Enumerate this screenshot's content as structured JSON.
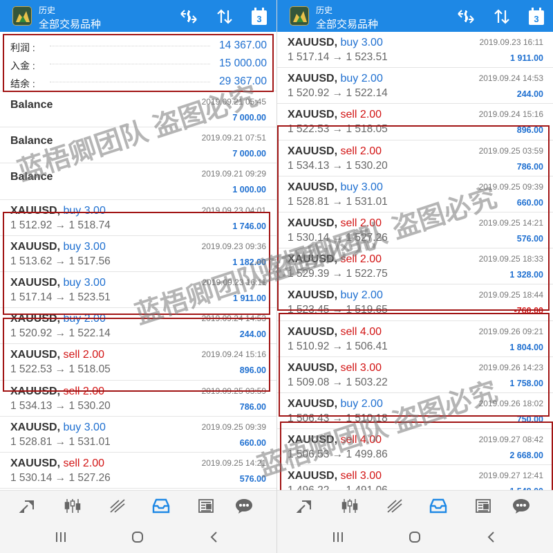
{
  "header": {
    "title_small": "历史",
    "title_main": "全部交易品种",
    "calendar_day": "3"
  },
  "summary": [
    {
      "label": "利润 :",
      "value": "14 367.00"
    },
    {
      "label": "入金 :",
      "value": "15 000.00"
    },
    {
      "label": "结余 :",
      "value": "29 367.00"
    }
  ],
  "balance_entries": [
    {
      "label": "Balance",
      "datetime": "2019.09.21 05:45",
      "amount": "7 000.00"
    },
    {
      "label": "Balance",
      "datetime": "2019.09.21 07:51",
      "amount": "7 000.00"
    },
    {
      "label": "Balance",
      "datetime": "2019.09.21 09:29",
      "amount": "1 000.00"
    }
  ],
  "arrow": "→",
  "trades": [
    {
      "symbol": "XAUUSD,",
      "side": "buy 3.00",
      "type": "buy",
      "datetime": "2019.09.23 04:01",
      "open": "1 512.92",
      "close": "1 518.74",
      "profit": "1 746.00"
    },
    {
      "symbol": "XAUUSD,",
      "side": "buy 3.00",
      "type": "buy",
      "datetime": "2019.09.23 09:36",
      "open": "1 513.62",
      "close": "1 517.56",
      "profit": "1 182.00"
    },
    {
      "symbol": "XAUUSD,",
      "side": "buy 3.00",
      "type": "buy",
      "datetime": "2019.09.23 16:11",
      "open": "1 517.14",
      "close": "1 523.51",
      "profit": "1 911.00"
    },
    {
      "symbol": "XAUUSD,",
      "side": "buy 2.00",
      "type": "buy",
      "datetime": "2019.09.24 14:53",
      "open": "1 520.92",
      "close": "1 522.14",
      "profit": "244.00"
    },
    {
      "symbol": "XAUUSD,",
      "side": "sell 2.00",
      "type": "sell",
      "datetime": "2019.09.24 15:16",
      "open": "1 522.53",
      "close": "1 518.05",
      "profit": "896.00"
    },
    {
      "symbol": "XAUUSD,",
      "side": "sell 2.00",
      "type": "sell",
      "datetime": "2019.09.25 03:59",
      "open": "1 534.13",
      "close": "1 530.20",
      "profit": "786.00"
    },
    {
      "symbol": "XAUUSD,",
      "side": "buy 3.00",
      "type": "buy",
      "datetime": "2019.09.25 09:39",
      "open": "1 528.81",
      "close": "1 531.01",
      "profit": "660.00"
    },
    {
      "symbol": "XAUUSD,",
      "side": "sell 2.00",
      "type": "sell",
      "datetime": "2019.09.25 14:21",
      "open": "1 530.14",
      "close": "1 527.26",
      "profit": "576.00"
    },
    {
      "symbol": "XAUUSD,",
      "side": "sell 2.00",
      "type": "sell",
      "datetime": "2019.09.25 18:33",
      "open": "1 529.39",
      "close": "1 522.75",
      "profit": "1 328.00"
    },
    {
      "symbol": "XAUUSD,",
      "side": "buy 2.00",
      "type": "buy",
      "datetime": "2019.09.25 18:44",
      "open": "1 523.45",
      "close": "1 519.65",
      "profit": "-760.00"
    },
    {
      "symbol": "XAUUSD,",
      "side": "sell 4.00",
      "type": "sell",
      "datetime": "2019.09.26 09:21",
      "open": "1 510.92",
      "close": "1 506.41",
      "profit": "1 804.00"
    },
    {
      "symbol": "XAUUSD,",
      "side": "sell 3.00",
      "type": "sell",
      "datetime": "2019.09.26 14:23",
      "open": "1 509.08",
      "close": "1 503.22",
      "profit": "1 758.00"
    },
    {
      "symbol": "XAUUSD,",
      "side": "buy 2.00",
      "type": "buy",
      "datetime": "2019.09.26 18:02",
      "open": "1 506.43",
      "close": "1 510.18",
      "profit": "750.00"
    },
    {
      "symbol": "XAUUSD,",
      "side": "sell 4.00",
      "type": "sell",
      "datetime": "2019.09.27 08:42",
      "open": "1 506.53",
      "close": "1 499.86",
      "profit": "2 668.00"
    },
    {
      "symbol": "XAUUSD,",
      "side": "sell 3.00",
      "type": "sell",
      "datetime": "2019.09.27 12:41",
      "open": "1 496.22",
      "close": "1 491.06",
      "profit": "1 548.00"
    }
  ],
  "watermark": "蓝梧卿团队 盗图必究",
  "nav_icons": [
    "quotes-icon",
    "chart-candles-icon",
    "trade-icon",
    "history-inbox-icon",
    "news-icon",
    "chat-icon"
  ],
  "system_nav": [
    "recent-apps-icon",
    "home-icon",
    "back-icon"
  ],
  "colors": {
    "header": "#1e88e5",
    "buy": "#1e6fd0",
    "sell": "#d21414",
    "profit": "#1e6fd0",
    "highlight_box": "#a11414"
  }
}
